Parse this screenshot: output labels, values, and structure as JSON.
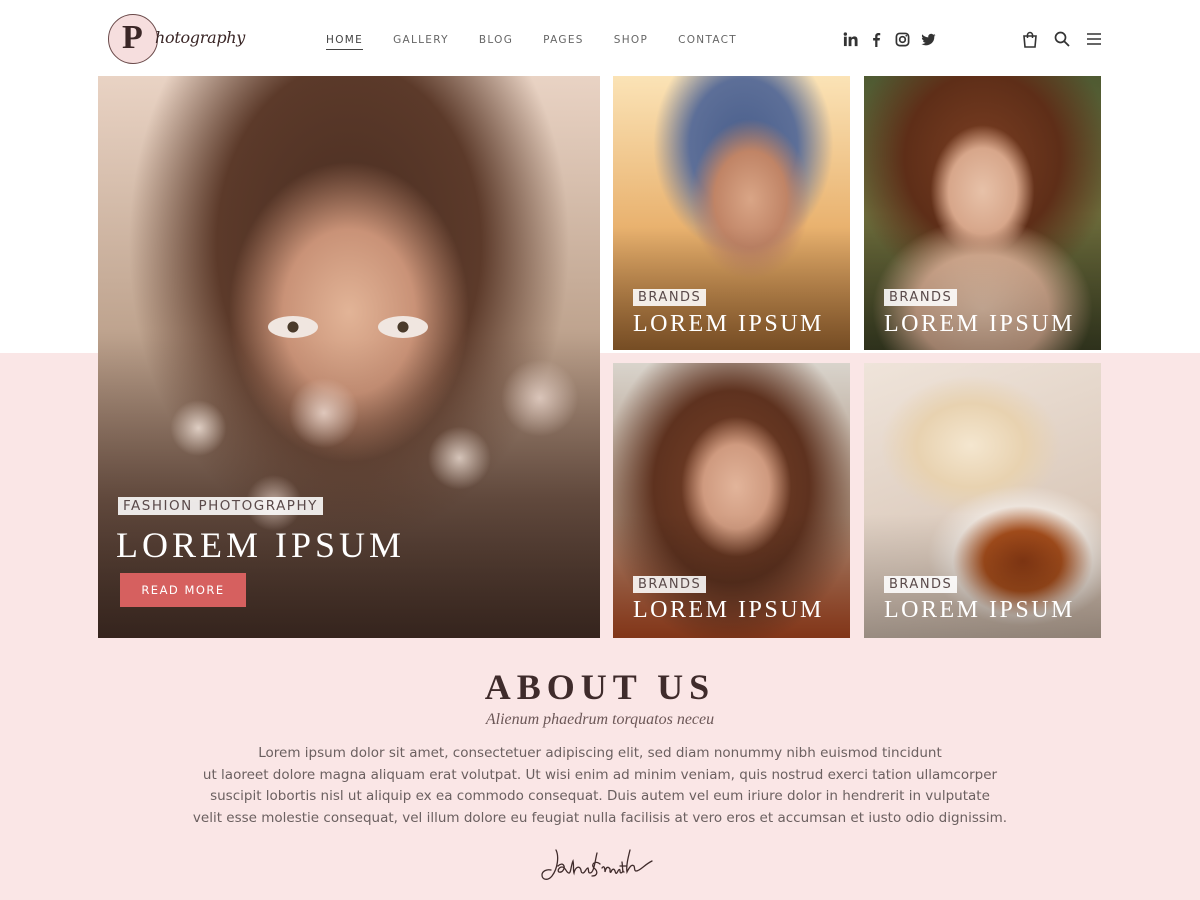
{
  "brand": {
    "logo_letter": "P",
    "logo_word": "hotography"
  },
  "nav": {
    "items": [
      {
        "label": "HOME",
        "active": true
      },
      {
        "label": "GALLERY"
      },
      {
        "label": "BLOG"
      },
      {
        "label": "PAGES"
      },
      {
        "label": "SHOP"
      },
      {
        "label": "CONTACT"
      }
    ]
  },
  "social": [
    "linkedin-icon",
    "facebook-icon",
    "instagram-icon",
    "twitter-icon"
  ],
  "tools": [
    "shopping-bag-icon",
    "search-icon",
    "menu-icon"
  ],
  "colors": {
    "accent": "#d6605f",
    "band": "#fae6e6",
    "heading": "#3f2b2b"
  },
  "hero": {
    "main": {
      "tag": "FASHION PHOTOGRAPHY",
      "title": "LOREM IPSUM",
      "button": "READ MORE"
    },
    "tiles": [
      {
        "tag": "BRANDS",
        "title": "LOREM IPSUM"
      },
      {
        "tag": "BRANDS",
        "title": "LOREM IPSUM"
      },
      {
        "tag": "BRANDS",
        "title": "LOREM IPSUM"
      },
      {
        "tag": "BRANDS",
        "title": "LOREM IPSUM"
      }
    ]
  },
  "about": {
    "title": "ABOUT US",
    "subtitle": "Alienum phaedrum torquatos neceu",
    "lines": [
      "Lorem ipsum dolor sit amet, consectetuer adipiscing elit, sed diam nonummy nibh euismod tincidunt",
      "ut laoreet dolore magna aliquam erat volutpat. Ut wisi enim ad minim veniam, quis nostrud exerci tation ullamcorper",
      "suscipit lobortis nisl ut aliquip ex ea commodo consequat. Duis autem vel eum iriure dolor in hendrerit in vulputate",
      "velit esse molestie consequat, vel illum dolore eu feugiat nulla facilisis at vero eros et accumsan et iusto odio dignissim."
    ],
    "signature": "JohnSmith"
  }
}
